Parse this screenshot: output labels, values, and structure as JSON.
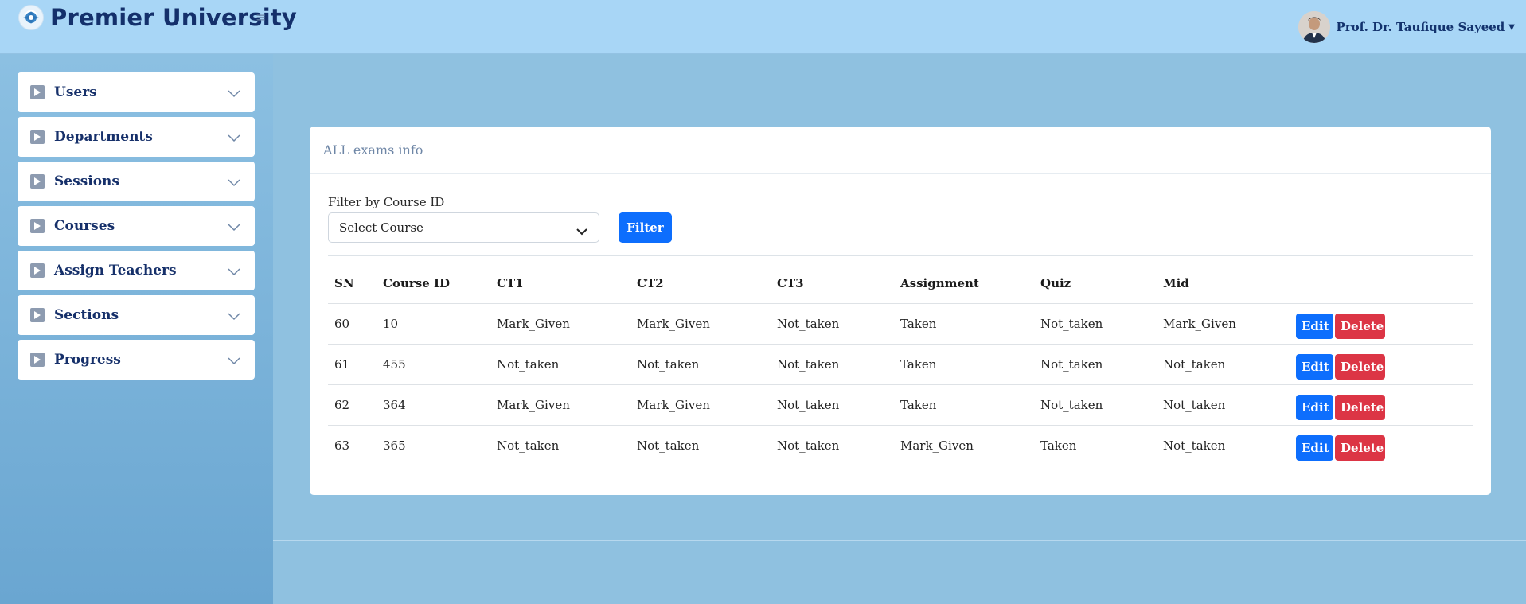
{
  "header": {
    "brand": "Premier University",
    "user_name": "Prof. Dr. Taufique Sayeed"
  },
  "sidebar": {
    "items": [
      {
        "label": "Users"
      },
      {
        "label": "Departments"
      },
      {
        "label": "Sessions"
      },
      {
        "label": "Courses"
      },
      {
        "label": "Assign Teachers"
      },
      {
        "label": "Sections"
      },
      {
        "label": "Progress"
      }
    ]
  },
  "main": {
    "card_title": "ALL exams info",
    "filter": {
      "label": "Filter by Course ID",
      "select_value": "Select Course",
      "button_label": "Filter"
    },
    "table": {
      "columns": [
        "SN",
        "Course ID",
        "CT1",
        "CT2",
        "CT3",
        "Assignment",
        "Quiz",
        "Mid"
      ],
      "rows": [
        [
          "60",
          "10",
          "Mark_Given",
          "Mark_Given",
          "Not_taken",
          "Taken",
          "Not_taken",
          "Mark_Given"
        ],
        [
          "61",
          "455",
          "Not_taken",
          "Not_taken",
          "Not_taken",
          "Taken",
          "Not_taken",
          "Not_taken"
        ],
        [
          "62",
          "364",
          "Mark_Given",
          "Mark_Given",
          "Not_taken",
          "Taken",
          "Not_taken",
          "Not_taken"
        ],
        [
          "63",
          "365",
          "Not_taken",
          "Not_taken",
          "Not_taken",
          "Mark_Given",
          "Taken",
          "Not_taken"
        ]
      ],
      "edit_label": "Edit",
      "delete_label": "Delete"
    }
  },
  "colors": {
    "primary": "#0d6efd",
    "danger": "#dc3545",
    "brand_text": "#14306b",
    "topbar": "#a8d6f6"
  },
  "icons": {
    "logo": "university-logo-icon",
    "menu": "hamburger-icon",
    "sidebar_item": "play-icon",
    "expand": "chevron-down-icon"
  }
}
